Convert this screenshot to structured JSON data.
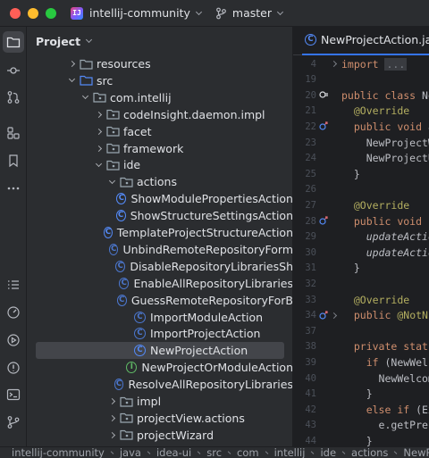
{
  "titlebar": {
    "project_badge": "IJ",
    "project_name": "intellij-community",
    "branch": "master"
  },
  "project_panel": {
    "title": "Project",
    "tree": [
      {
        "label": "resources",
        "kind": "folder",
        "depth": 3,
        "expanded": false
      },
      {
        "label": "src",
        "kind": "folder",
        "depth": 3,
        "expanded": true
      },
      {
        "label": "com.intellij",
        "kind": "package",
        "depth": 4,
        "expanded": true
      },
      {
        "label": "codeInsight.daemon.impl",
        "kind": "package",
        "depth": 5,
        "expanded": false
      },
      {
        "label": "facet",
        "kind": "package",
        "depth": 5,
        "expanded": false
      },
      {
        "label": "framework",
        "kind": "package",
        "depth": 5,
        "expanded": false
      },
      {
        "label": "ide",
        "kind": "package",
        "depth": 5,
        "expanded": true
      },
      {
        "label": "actions",
        "kind": "package",
        "depth": 6,
        "expanded": true
      },
      {
        "label": "ShowModulePropertiesAction",
        "kind": "class",
        "depth": 7
      },
      {
        "label": "ShowStructureSettingsAction",
        "kind": "class",
        "depth": 7
      },
      {
        "label": "TemplateProjectStructureAction",
        "kind": "class",
        "depth": 7
      },
      {
        "label": "UnbindRemoteRepositoryForm",
        "kind": "class-dim",
        "depth": 7
      },
      {
        "label": "DisableRepositoryLibrariesSh",
        "kind": "class-dim",
        "depth": 7
      },
      {
        "label": "EnableAllRepositoryLibraries",
        "kind": "class-dim",
        "depth": 7
      },
      {
        "label": "GuessRemoteRepositoryForB",
        "kind": "class-dim",
        "depth": 7
      },
      {
        "label": "ImportModuleAction",
        "kind": "class-dim",
        "depth": 7
      },
      {
        "label": "ImportProjectAction",
        "kind": "class-dim",
        "depth": 7
      },
      {
        "label": "NewProjectAction",
        "kind": "class",
        "depth": 7,
        "selected": true
      },
      {
        "label": "NewProjectOrModuleAction",
        "kind": "interface",
        "depth": 7
      },
      {
        "label": "ResolveAllRepositoryLibraries",
        "kind": "class-dim",
        "depth": 7
      },
      {
        "label": "impl",
        "kind": "package",
        "depth": 6,
        "expanded": false
      },
      {
        "label": "projectView.actions",
        "kind": "package",
        "depth": 6,
        "expanded": false
      },
      {
        "label": "projectWizard",
        "kind": "package",
        "depth": 6,
        "expanded": false
      }
    ]
  },
  "editor": {
    "tab_label": "NewProjectAction.java",
    "lines": [
      {
        "n": "4",
        "html": "<span class='kw'>import</span> <span class='fold-txt'>...</span>",
        "fold": "right"
      },
      {
        "n": "19",
        "html": ""
      },
      {
        "n": "20",
        "html": "<span class='kw'>public class</span> NewProjectAction",
        "gut": "impl"
      },
      {
        "n": "21",
        "html": "  <span class='ann'>@Override</span>"
      },
      {
        "n": "22",
        "html": "  <span class='kw'>public void</span> actionPerformed",
        "gut": "override"
      },
      {
        "n": "23",
        "html": "    NewProjectWizard"
      },
      {
        "n": "24",
        "html": "    NewProjectUtil"
      },
      {
        "n": "25",
        "html": "  }"
      },
      {
        "n": "26",
        "html": ""
      },
      {
        "n": "27",
        "html": "  <span class='ann'>@Override</span>"
      },
      {
        "n": "28",
        "html": "  <span class='kw'>public void</span> update",
        "gut": "override"
      },
      {
        "n": "29",
        "html": "    <span class='it'>updateActionIcon</span>"
      },
      {
        "n": "30",
        "html": "    <span class='it'>updateActionText</span>"
      },
      {
        "n": "31",
        "html": "  }"
      },
      {
        "n": "32",
        "html": ""
      },
      {
        "n": "33",
        "html": "  <span class='ann'>@Override</span>"
      },
      {
        "n": "34",
        "html": "  <span class='kw'>public</span> <span class='ann'>@NotNull</span>",
        "gut": "override",
        "fold": "right"
      },
      {
        "n": "37",
        "html": ""
      },
      {
        "n": "38",
        "html": "  <span class='kw'>private static</span>"
      },
      {
        "n": "39",
        "html": "    <span class='kw'>if</span> (NewWelcome"
      },
      {
        "n": "40",
        "html": "      NewWelcomeScreen"
      },
      {
        "n": "41",
        "html": "    }"
      },
      {
        "n": "42",
        "html": "    <span class='kw'>else if</span> (Expe"
      },
      {
        "n": "43",
        "html": "      e.getPresentation"
      },
      {
        "n": "44",
        "html": "    }"
      }
    ]
  },
  "statusbar": {
    "crumbs": [
      "intellij-community",
      "java",
      "idea-ui",
      "src",
      "com",
      "intellij",
      "ide",
      "actions",
      "NewProjectAction"
    ]
  },
  "colors": {
    "accent": "#3574f0",
    "class_icon": "#548af7",
    "interface_icon": "#5fb865",
    "folder": "#9aa7b0"
  }
}
